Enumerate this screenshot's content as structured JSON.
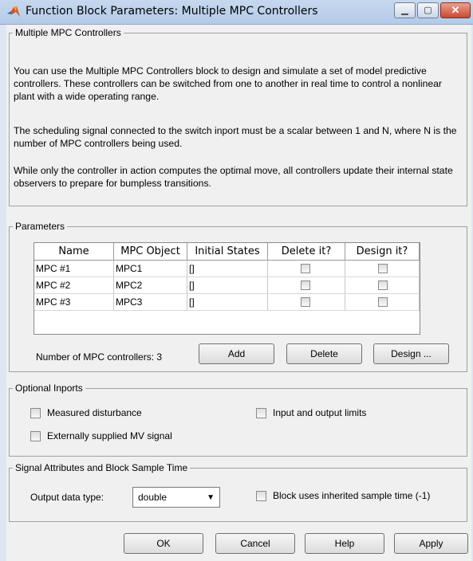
{
  "window": {
    "title": "Function Block Parameters: Multiple MPC Controllers",
    "min_glyph": "▁",
    "max_glyph": "▢",
    "close_glyph": "✕"
  },
  "description": {
    "group_label": "Multiple MPC Controllers",
    "para1": "You can use the Multiple MPC Controllers block to design and simulate a set of model predictive controllers. These controllers can be switched from one to another in real time to control a nonlinear plant with a wide operating range.",
    "para2": "The scheduling signal connected to the switch inport must be a scalar between 1 and N, where N is the number of MPC controllers being used.",
    "para3": "While only the controller in action computes the optimal move, all controllers update their internal state observers to prepare for bumpless transitions."
  },
  "parameters": {
    "group_label": "Parameters",
    "columns": [
      "Name",
      "MPC Object",
      "Initial States",
      "Delete it?",
      "Design it?"
    ],
    "rows": [
      {
        "name": "MPC #1",
        "object": "MPC1",
        "initial": "[]",
        "delete": false,
        "design": false
      },
      {
        "name": "MPC #2",
        "object": "MPC2",
        "initial": "[]",
        "delete": false,
        "design": false
      },
      {
        "name": "MPC #3",
        "object": "MPC3",
        "initial": "[]",
        "delete": false,
        "design": false
      }
    ],
    "count_label": "Number of MPC controllers: 3",
    "add_label": "Add",
    "delete_label": "Delete",
    "design_label": "Design ..."
  },
  "optional_inports": {
    "group_label": "Optional Inports",
    "measured_disturbance": "Measured disturbance",
    "io_limits": "Input and output limits",
    "external_mv": "Externally supplied MV signal"
  },
  "signal": {
    "group_label": "Signal Attributes and Block Sample Time",
    "output_type_label": "Output data type:",
    "output_type_value": "double",
    "inherited_label": "Block uses inherited sample time (-1)"
  },
  "buttons": {
    "ok": "OK",
    "cancel": "Cancel",
    "help": "Help",
    "apply": "Apply"
  }
}
